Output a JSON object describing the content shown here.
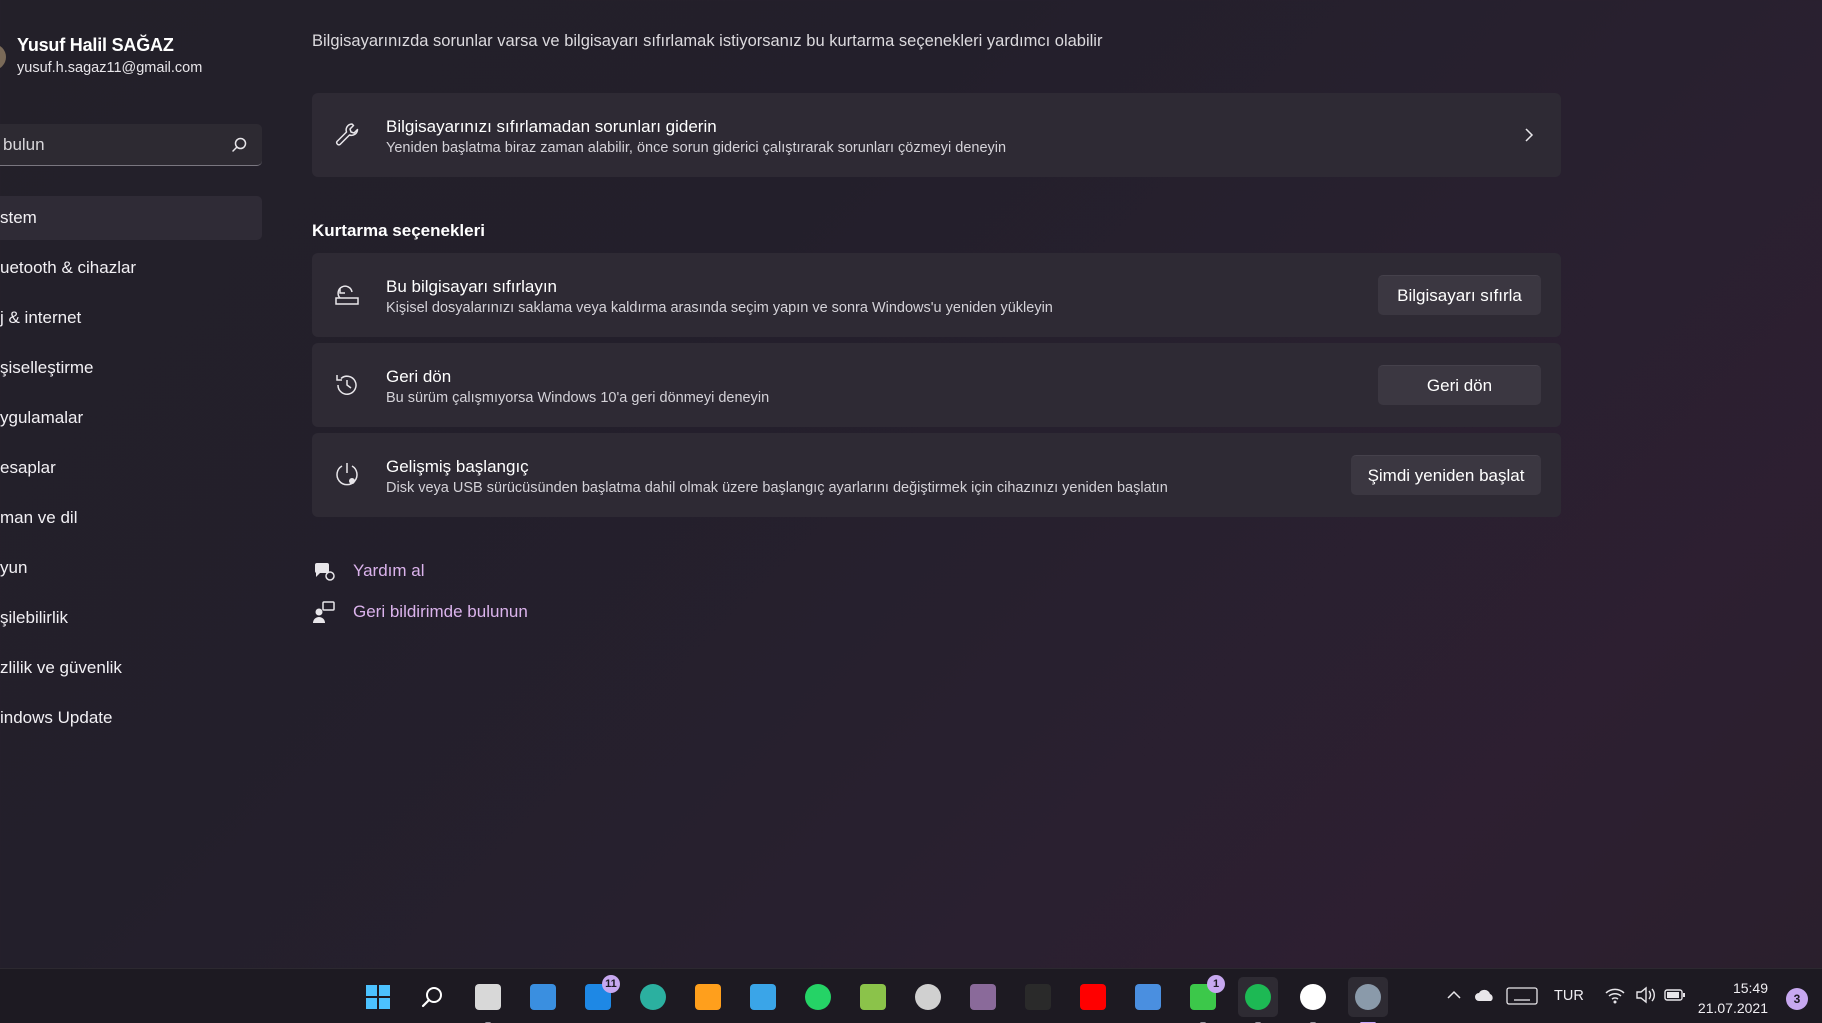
{
  "profile": {
    "name": "Yusuf Halil SAĞAZ",
    "email": "yusuf.h.sagaz11@gmail.com"
  },
  "search": {
    "text": "bulun",
    "icon": "search-icon"
  },
  "nav": {
    "items": [
      {
        "label": "stem",
        "active": true
      },
      {
        "label": "uetooth & cihazlar"
      },
      {
        "label": "j & internet"
      },
      {
        "label": "şiselleştirme"
      },
      {
        "label": "ygulamalar"
      },
      {
        "label": "esaplar"
      },
      {
        "label": "man ve dil"
      },
      {
        "label": "yun"
      },
      {
        "label": "şilebilirlik"
      },
      {
        "label": "zlilik ve güvenlik"
      },
      {
        "label": "indows Update"
      }
    ]
  },
  "main": {
    "intro": "Bilgisayarınızda sorunlar varsa ve bilgisayarı sıfırlamak istiyorsanız bu kurtarma seçenekleri yardımcı olabilir",
    "troubleshoot": {
      "title": "Bilgisayarınızı sıfırlamadan sorunları giderin",
      "desc": "Yeniden başlatma biraz zaman alabilir, önce sorun giderici çalıştırarak sorunları çözmeyi deneyin",
      "icon": "wrench-icon"
    },
    "section_title": "Kurtarma seçenekleri",
    "options": [
      {
        "title": "Bu bilgisayarı sıfırlayın",
        "desc": "Kişisel dosyalarınızı saklama veya kaldırma arasında seçim yapın ve sonra Windows'u yeniden yükleyin",
        "button": "Bilgisayarı sıfırla",
        "icon": "reset-pc-icon"
      },
      {
        "title": "Geri dön",
        "desc": "Bu sürüm çalışmıyorsa Windows 10'a geri dönmeyi deneyin",
        "button": "Geri dön",
        "icon": "history-icon"
      },
      {
        "title": "Gelişmiş başlangıç",
        "desc": "Disk veya USB sürücüsünden başlatma dahil olmak üzere başlangıç ayarlarını değiştirmek için cihazınızı yeniden başlatın",
        "button": "Şimdi yeniden başlat",
        "icon": "advanced-startup-icon"
      }
    ],
    "links": [
      {
        "label": "Yardım al",
        "icon": "help-chat-icon"
      },
      {
        "label": "Geri bildirimde bulunun",
        "icon": "feedback-icon"
      }
    ]
  },
  "taskbar": {
    "apps": [
      {
        "name": "start",
        "color": "#4cc2ff"
      },
      {
        "name": "search",
        "color": "#ffffff"
      },
      {
        "name": "task-view",
        "color": "#d8d8d8"
      },
      {
        "name": "widgets",
        "color": "#3a8fe0"
      },
      {
        "name": "store",
        "color": "#1e88e5",
        "badge": "11"
      },
      {
        "name": "edge",
        "color": "#2bb0a0"
      },
      {
        "name": "snip",
        "color": "#ff9f1c"
      },
      {
        "name": "file-explorer",
        "color": "#3aa5e8"
      },
      {
        "name": "whatsapp",
        "color": "#25d366"
      },
      {
        "name": "bluestacks",
        "color": "#8bc34a"
      },
      {
        "name": "obs",
        "color": "#d0d0d0"
      },
      {
        "name": "game",
        "color": "#8a6a9a"
      },
      {
        "name": "epic-games",
        "color": "#2a2a2a"
      },
      {
        "name": "youtube",
        "color": "#ff0000"
      },
      {
        "name": "teams",
        "color": "#4a8fe0"
      },
      {
        "name": "power",
        "color": "#3cc84a",
        "badge": "1"
      },
      {
        "name": "spotify",
        "color": "#1db954"
      },
      {
        "name": "xbox",
        "color": "#ffffff"
      },
      {
        "name": "settings",
        "color": "#8a9aaa"
      }
    ],
    "tray": {
      "language": "TUR",
      "time": "15:49",
      "date": "21.07.2021",
      "notifications": "3"
    }
  }
}
